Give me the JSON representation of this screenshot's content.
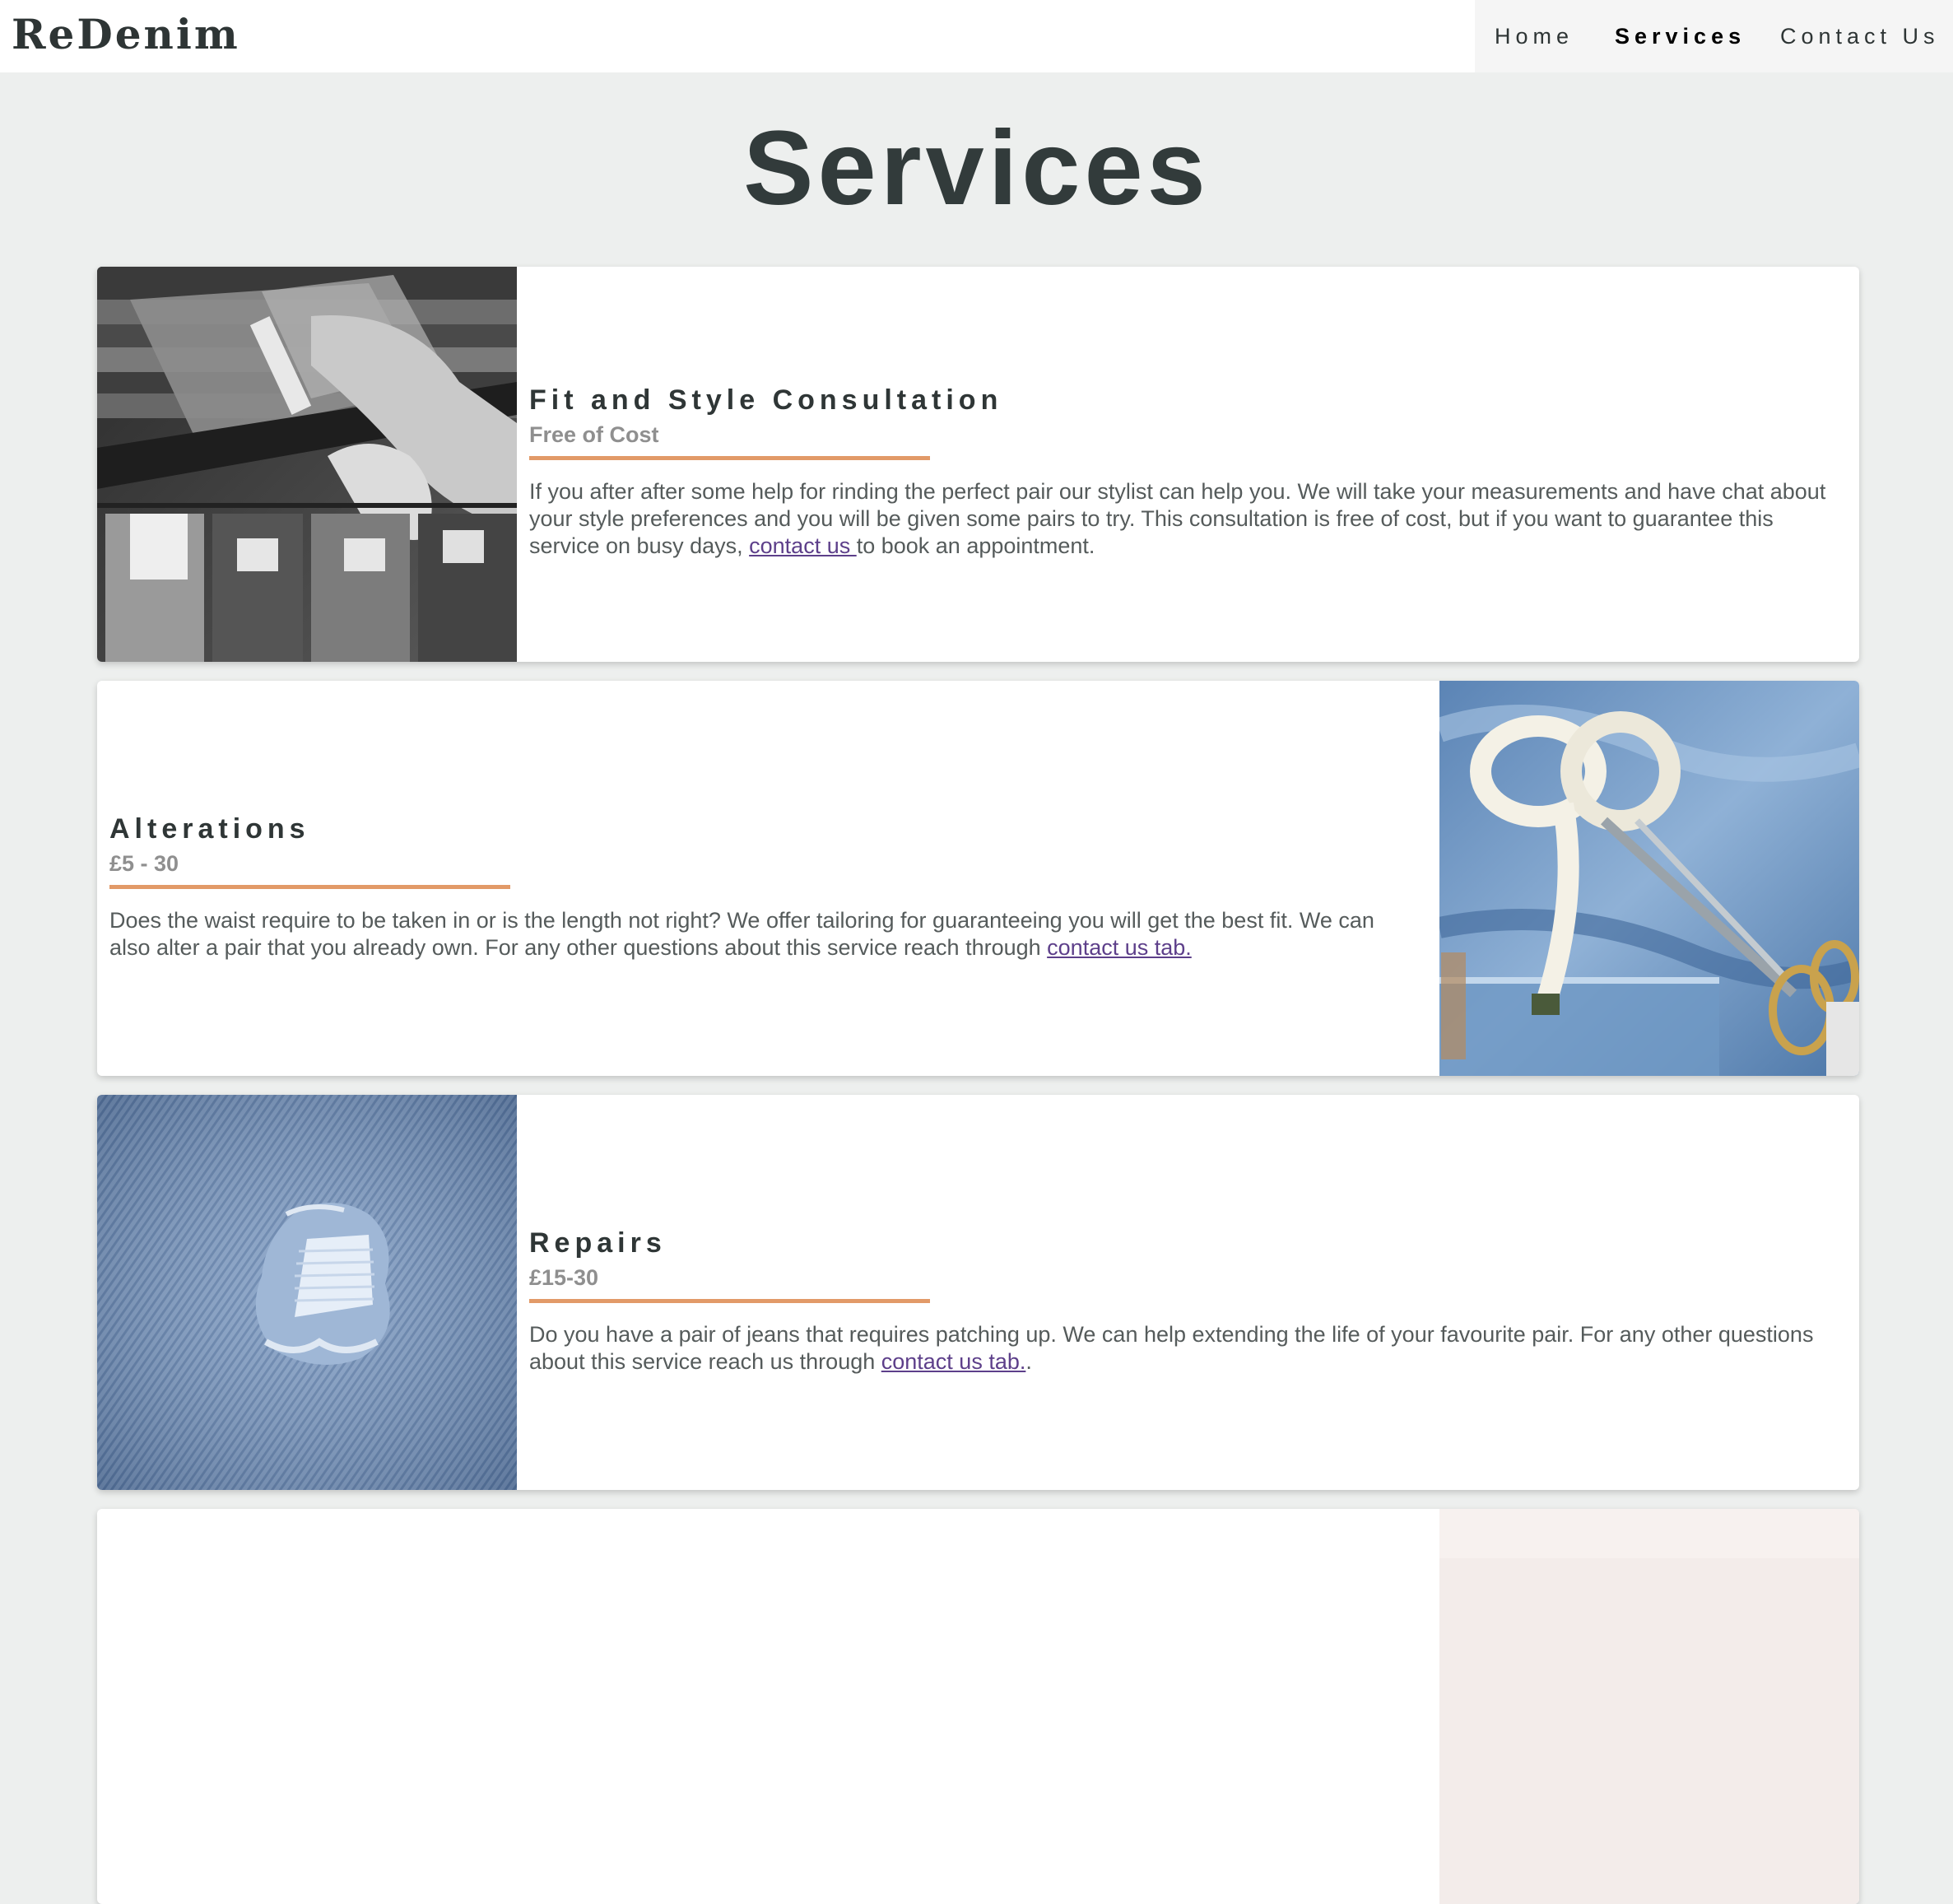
{
  "header": {
    "brand": "ReDenim",
    "nav": [
      {
        "label": "Home",
        "active": false
      },
      {
        "label": "Services",
        "active": true
      },
      {
        "label": "Contact Us",
        "active": false
      }
    ]
  },
  "page": {
    "title": "Services"
  },
  "services": [
    {
      "title": "Fit and Style Consultation",
      "price": "Free of Cost",
      "desc_before": "If you after after some help for rinding the perfect pair our stylist can help you. We will take your measurements and have chat about your style preferences and you will be given some pairs to try. This consultation is free of cost, but if you want to guarantee this service on busy days, ",
      "link": "contact us ",
      "desc_after": "to book an appointment.",
      "image": "jeans-on-shelf-photo"
    },
    {
      "title": "Alterations",
      "price": "£5 - 30",
      "desc_before": "Does the waist require to be taken in or is the length not right? We offer tailoring for guaranteeing you will get the best fit. We can also alter a pair that you already own. For any other questions about this service reach through ",
      "link": "contact us tab.",
      "desc_after": "",
      "image": "tape-measure-scissors-photo"
    },
    {
      "title": "Repairs",
      "price": "£15-30",
      "desc_before": "Do you have a pair of jeans that requires patching up. We can help extending the life of your favourite pair. For any other questions about this service reach us through ",
      "link": "contact us tab.",
      "desc_after": ".",
      "image": "ripped-denim-photo"
    }
  ],
  "colors": {
    "accent_rule": "#e29a68",
    "background": "#edefee",
    "link": "#5d3f8a"
  }
}
